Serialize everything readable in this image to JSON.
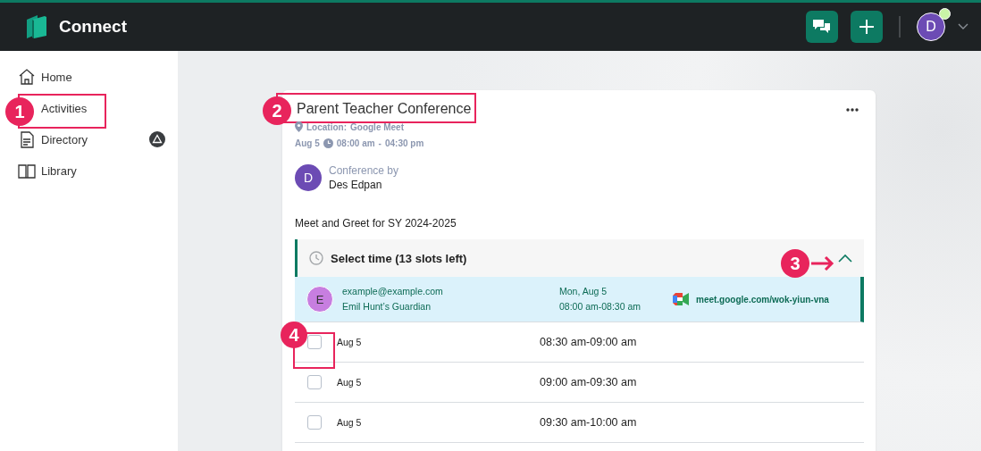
{
  "header": {
    "app_name": "Connect",
    "avatar_letter": "D",
    "online": true
  },
  "sidebar": {
    "items": [
      {
        "label": "Home",
        "warning": false
      },
      {
        "label": "Activities",
        "warning": false
      },
      {
        "label": "Directory",
        "warning": true
      },
      {
        "label": "Library",
        "warning": false
      }
    ]
  },
  "event": {
    "title": "Parent Teacher Conference",
    "location_label": "Location:",
    "location": "Google Meet",
    "date": "Aug 5",
    "start": "08:00 am",
    "separator": "-",
    "end": "04:30 pm",
    "organizer_label": "Conference by",
    "organizer": "Des Edpan",
    "organizer_initial": "D",
    "description": "Meet and Greet for SY 2024-2025"
  },
  "time_section": {
    "title": "Select time (13 slots left)",
    "expanded": true,
    "booked": {
      "initial": "E",
      "email": "example@example.com",
      "guardian": "Emil Hunt’s Guardian",
      "date": "Mon, Aug 5",
      "time": "08:00 am-08:30 am",
      "link": "meet.google.com/wok-yiun-vna"
    },
    "slots": [
      {
        "date": "Aug 5",
        "time": "08:30 am-09:00 am",
        "checked": false
      },
      {
        "date": "Aug 5",
        "time": "09:00 am-09:30 am",
        "checked": false
      },
      {
        "date": "Aug 5",
        "time": "09:30 am-10:00 am",
        "checked": false
      }
    ]
  },
  "annotations": [
    {
      "number": "1"
    },
    {
      "number": "2"
    },
    {
      "number": "3"
    },
    {
      "number": "4"
    }
  ]
}
